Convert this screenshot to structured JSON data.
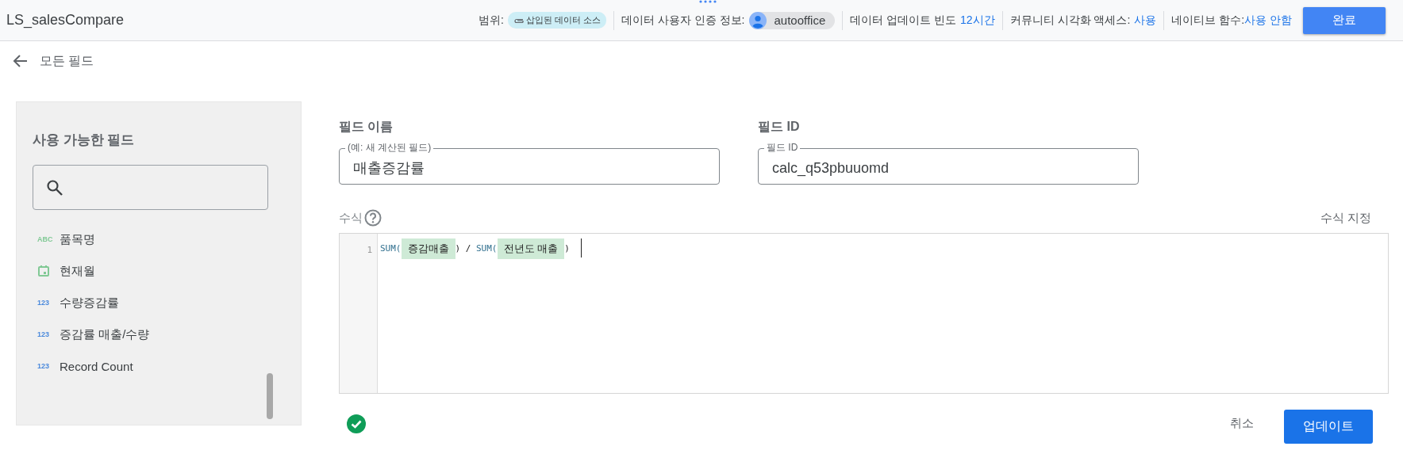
{
  "header": {
    "title": "LS_salesCompare",
    "scope_label": "범위:",
    "scope_chip": "삽입된 데이터 소스",
    "credentials_label": "데이터 사용자 인증 정보:",
    "credentials_user": "autooffice",
    "freshness_label": "데이터 업데이트 빈도",
    "freshness_value": "12시간",
    "community_label": "커뮤니티 시각화 액세스:",
    "community_value": "사용",
    "native_label": "네이티브 함수:",
    "native_value": "사용 안함",
    "done_button": "완료"
  },
  "back": {
    "label": "모든 필드"
  },
  "sidebar": {
    "title": "사용 가능한 필드",
    "items": [
      {
        "kind": "text",
        "type_label": "ABC",
        "label": "품목명"
      },
      {
        "kind": "date",
        "label": "현재월"
      },
      {
        "kind": "number",
        "type_label": "123",
        "label": "수량증감률"
      },
      {
        "kind": "number",
        "type_label": "123",
        "label": "증감률 매출/수량"
      },
      {
        "kind": "number",
        "type_label": "123",
        "label": "Record Count"
      }
    ]
  },
  "field_name": {
    "heading": "필드 이름",
    "placeholder": "(예: 새 계산된 필드)",
    "value": "매출증감률"
  },
  "field_id": {
    "heading": "필드 ID",
    "label": "필드 ID",
    "value": "calc_q53pbuuomd"
  },
  "formula": {
    "label": "수식",
    "format_link": "수식 지정",
    "line_number": "1",
    "valid": true,
    "tokens": [
      {
        "kind": "func",
        "text": "SUM("
      },
      {
        "kind": "field",
        "text": "증감매출"
      },
      {
        "kind": "op",
        "text": ") / "
      },
      {
        "kind": "func",
        "text": "SUM("
      },
      {
        "kind": "field",
        "text": "전년도 매출"
      },
      {
        "kind": "op",
        "text": ")"
      }
    ]
  },
  "actions": {
    "cancel": "취소",
    "update": "업데이트"
  }
}
